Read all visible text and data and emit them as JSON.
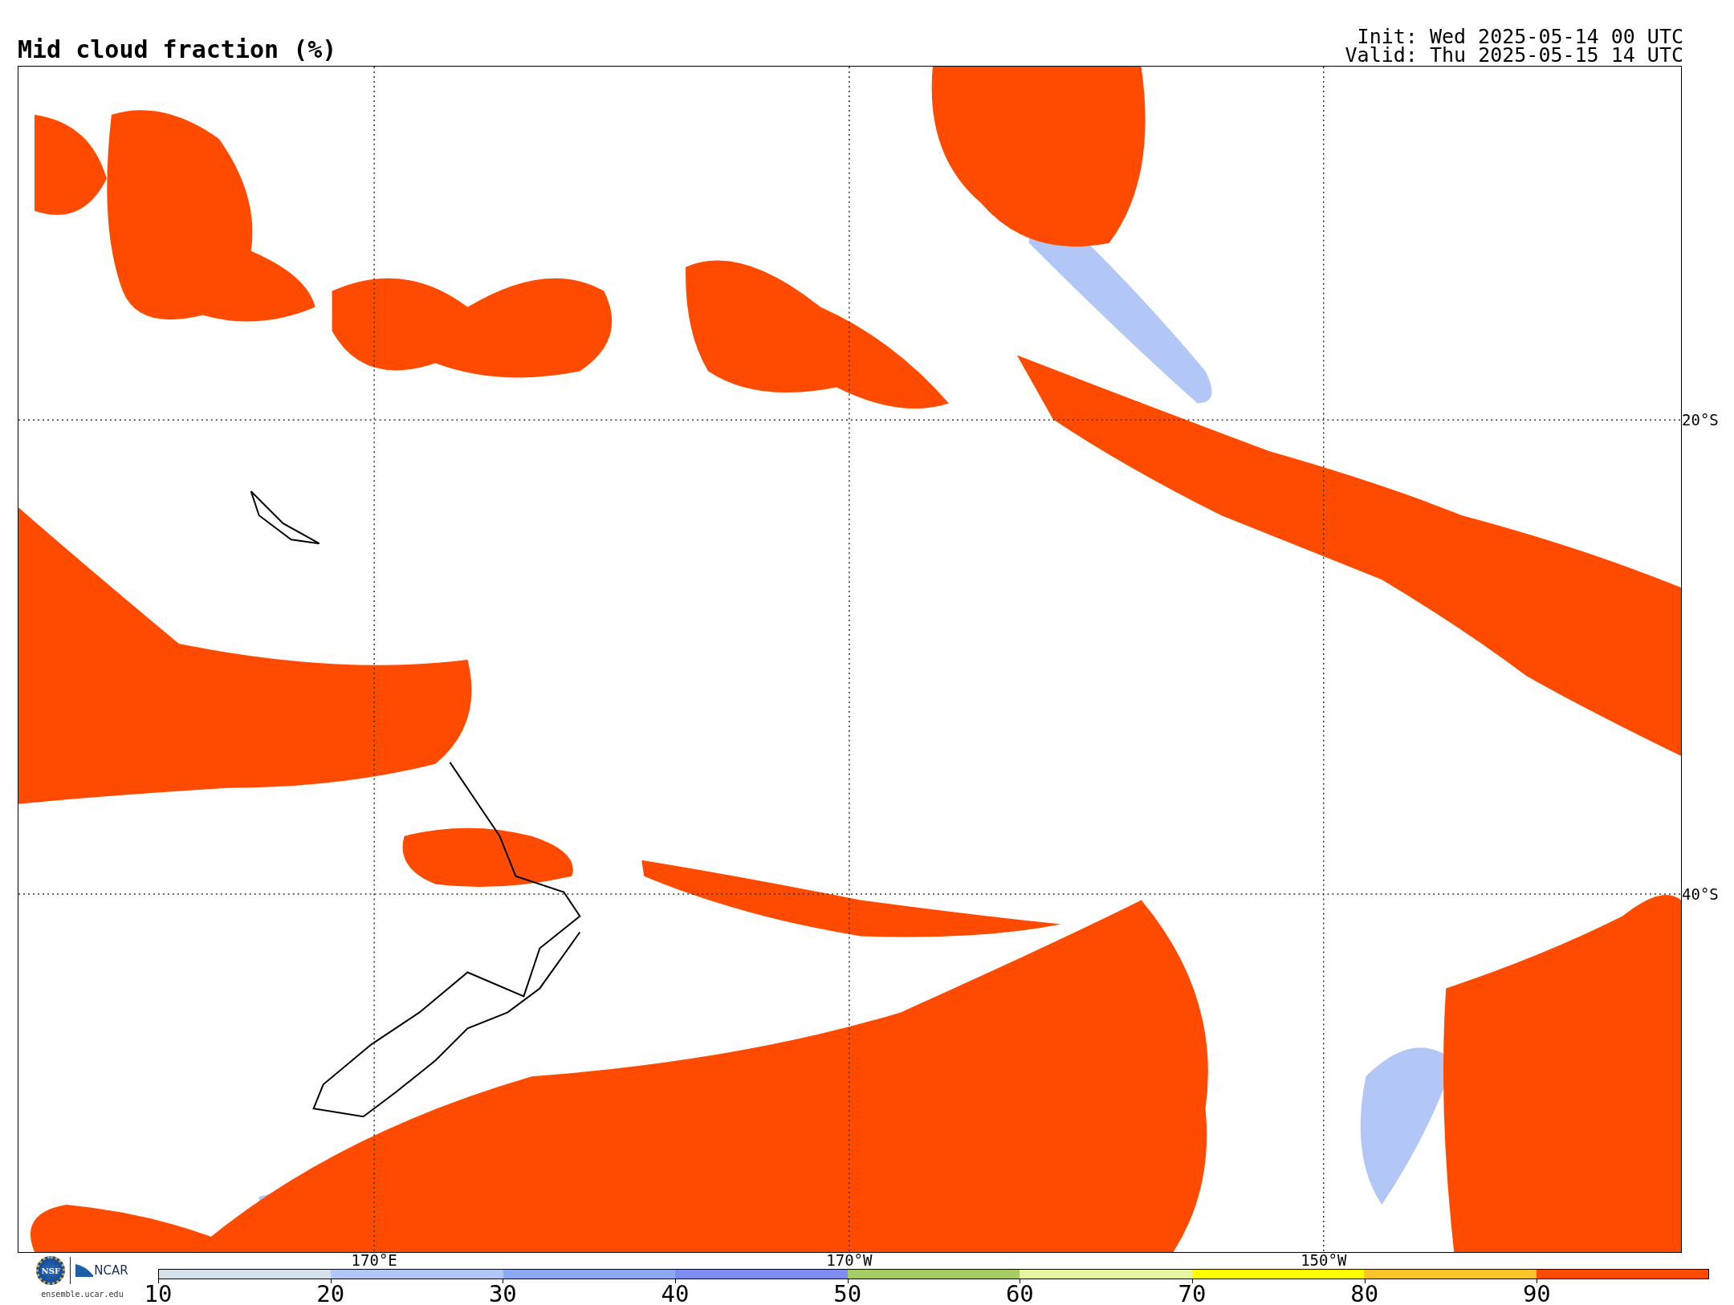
{
  "title": "Mid cloud fraction (%)",
  "init": "Init: Wed 2025-05-14 00 UTC",
  "valid": "Valid: Thu 2025-05-15 14 UTC",
  "latitude_labels": [
    "20°S",
    "40°S"
  ],
  "longitude_labels": [
    "170°E",
    "170°W",
    "150°W"
  ],
  "colorbar": {
    "segments": [
      {
        "color": "#d5e1ea"
      },
      {
        "color": "#b3c7f7"
      },
      {
        "color": "#8aa9f7"
      },
      {
        "color": "#7d8df3"
      },
      {
        "color": "#a6cd63"
      },
      {
        "color": "#e6f5a3"
      },
      {
        "color": "#ffff00"
      },
      {
        "color": "#fcc52b"
      },
      {
        "color": "#ff4b00"
      }
    ],
    "ticks": [
      "10",
      "20",
      "30",
      "40",
      "50",
      "60",
      "70",
      "80",
      "90"
    ]
  },
  "logos": {
    "seal": "NSF",
    "wordmark": "NCAR",
    "url": "ensemble.ucar.edu"
  }
}
